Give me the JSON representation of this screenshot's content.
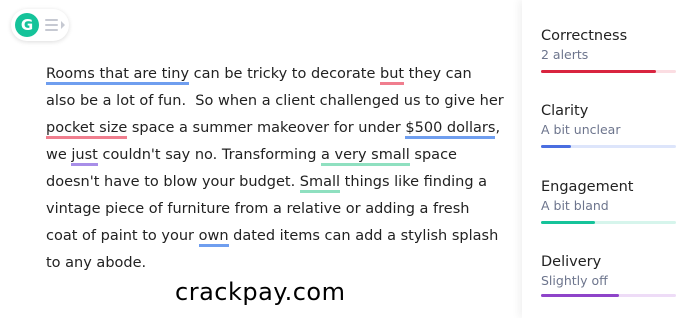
{
  "widget": {
    "logo_letter": "G",
    "logo_color": "#15c39a"
  },
  "document": {
    "lines": [
      [
        {
          "t": "Rooms that are tiny",
          "u": "blue"
        },
        {
          "t": " can be tricky to decorate "
        },
        {
          "t": "but",
          "u": "red"
        },
        {
          "t": " they can"
        }
      ],
      [
        {
          "t": "also be a lot of fun.  So when a client challenged us to give her"
        }
      ],
      [
        {
          "t": "pocket size",
          "u": "red"
        },
        {
          "t": " space a summer makeover for under "
        },
        {
          "t": "$500 dollars",
          "u": "blue"
        },
        {
          "t": ","
        }
      ],
      [
        {
          "t": "we "
        },
        {
          "t": "just",
          "u": "purple"
        },
        {
          "t": " couldn't say no. Transforming "
        },
        {
          "t": "a very small",
          "u": "green"
        },
        {
          "t": " space"
        }
      ],
      [
        {
          "t": "doesn't have to blow your budget. "
        },
        {
          "t": "Small",
          "u": "green"
        },
        {
          "t": " things like finding a"
        }
      ],
      [
        {
          "t": "vintage piece of furniture from a relative or adding a fresh"
        }
      ],
      [
        {
          "t": "coat of paint to your "
        },
        {
          "t": "own",
          "u": "blue"
        },
        {
          "t": " dated items can add a stylish splash"
        }
      ],
      [
        {
          "t": "to any abode."
        }
      ]
    ]
  },
  "sidebar": {
    "cards": [
      {
        "title": "Correctness",
        "subtitle": "2 alerts",
        "color": "#d9243f",
        "track": "#fbdde2",
        "progress": 0.85
      },
      {
        "title": "Clarity",
        "subtitle": "A bit unclear",
        "color": "#4a6ee0",
        "track": "#dde5fb",
        "progress": 0.22
      },
      {
        "title": "Engagement",
        "subtitle": "A bit bland",
        "color": "#15c39a",
        "track": "#d6f5ec",
        "progress": 0.4
      },
      {
        "title": "Delivery",
        "subtitle": "Slightly off",
        "color": "#8e44c9",
        "track": "#eedcf7",
        "progress": 0.58
      }
    ]
  },
  "watermark": "crackpay.com"
}
